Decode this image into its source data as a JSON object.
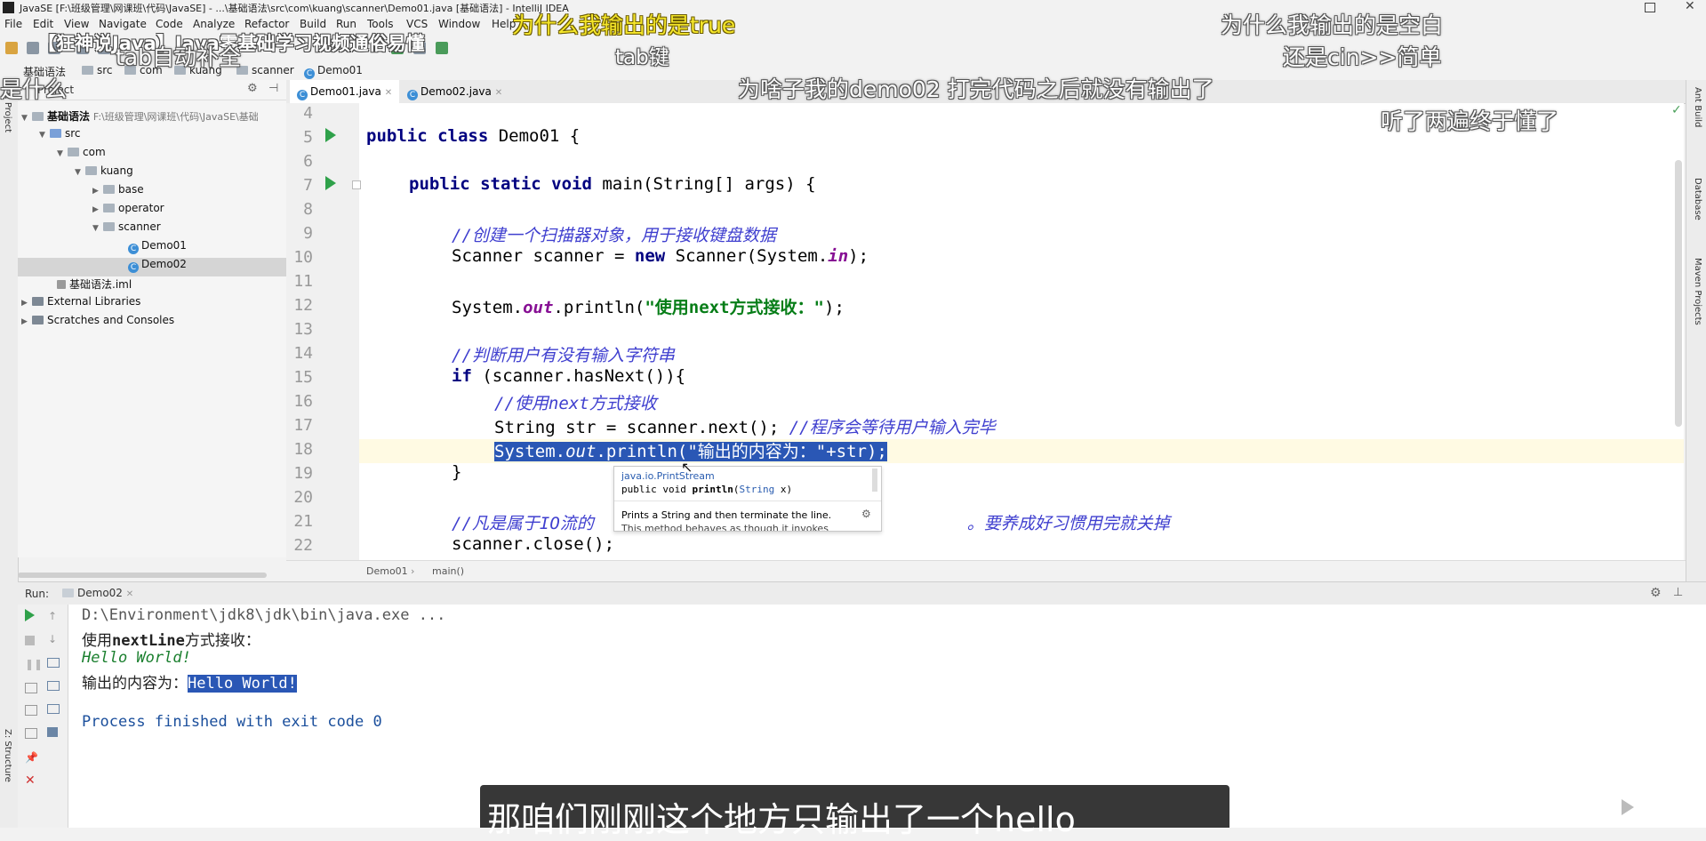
{
  "window": {
    "title": "JavaSE [F:\\班级管理\\网课班\\代码\\JavaSE] - ...\\基础语法\\src\\com\\kuang\\scanner\\Demo01.java [基础语法] - IntelliJ IDEA"
  },
  "overlay_title": "【狂神说Java】Java零基础学习视频通俗易懂",
  "menu": [
    "File",
    "Edit",
    "View",
    "Navigate",
    "Code",
    "Analyze",
    "Refactor",
    "Build",
    "Run",
    "Tools",
    "VCS",
    "Window",
    "Help"
  ],
  "breadcrumb": [
    "基础语法",
    "src",
    "com",
    "kuang",
    "scanner",
    "Demo01"
  ],
  "project": {
    "header": "Project",
    "root_name": "基础语法",
    "root_path": "F:\\班级管理\\网课班\\代码\\JavaSE\\基础",
    "items": [
      "src",
      "com",
      "kuang",
      "base",
      "operator",
      "scanner",
      "Demo01",
      "Demo02",
      "基础语法.iml",
      "External Libraries",
      "Scratches and Consoles"
    ]
  },
  "editor_tabs": [
    "Demo01.java",
    "Demo02.java"
  ],
  "code": {
    "line_numbers": [
      "4",
      "5",
      "6",
      "7",
      "8",
      "9",
      "10",
      "11",
      "12",
      "13",
      "14",
      "15",
      "16",
      "17",
      "18",
      "19",
      "20",
      "21",
      "22"
    ],
    "l5_kw": "public class",
    "l5_rest": " Demo01 {",
    "l7_kw": "public static void",
    "l7_rest": " main(String[] args) {",
    "l9": "//创建一个扫描器对象，用于接收键盘数据",
    "l10_a": "Scanner scanner = ",
    "l10_kw": "new",
    "l10_b": " Scanner(System.",
    "l10_fld": "in",
    "l10_c": ");",
    "l12_a": "System.",
    "l12_fld": "out",
    "l12_b": ".println(",
    "l12_str": "\"使用next方式接收：\"",
    "l12_c": ");",
    "l14": "//判断用户有没有输入字符串",
    "l15_kw": "if",
    "l15_rest": " (scanner.hasNext()){",
    "l16": "//使用next方式接收",
    "l17_a": "String str = scanner.next(); ",
    "l17_cm": "//程序会等待用户输入完毕",
    "l18_a": "System.",
    "l18_fld": "out",
    "l18_b": ".println(\"输出的内容为：\"+str);",
    "l19": "}",
    "l21_a": "//凡是属于IO流的",
    "l21_b": "。要养成好习惯用完就关掉",
    "l22": "scanner.close();"
  },
  "doc_popup": {
    "pkg": "java.io.PrintStream",
    "sig_a": "public void ",
    "sig_b": "println",
    "sig_c": "(",
    "sig_type": "String",
    "sig_d": " x)",
    "desc": "Prints a String and then terminate the line.",
    "desc2": "This method behaves as though it invokes"
  },
  "editor_breadcrumb": [
    "Demo01",
    "main()"
  ],
  "run": {
    "label": "Run:",
    "tab": "Demo02",
    "lines": {
      "cmd": "D:\\Environment\\jdk8\\jdk\\bin\\java.exe ...",
      "l2_a": "使用",
      "l2_b": "nextLine",
      "l2_c": "方式接收：",
      "l3": "Hello World!",
      "l4_a": "输出的内容为：",
      "l4_b": "Hello World!",
      "l6": "Process finished with exit code 0"
    }
  },
  "right_tools": [
    "Ant Build",
    "Database",
    "Maven Projects"
  ],
  "left_tools": [
    "1: Project",
    "Z: Structure"
  ],
  "danmaku": [
    "为什么我输出的是true",
    "tab键",
    "为什么我输出的是空白",
    "还是cin>>简单",
    "为啥子我的demo02 打完代码之后就没有输出了",
    "听了两遍终于懂了",
    "tab自动补全",
    "是什么"
  ],
  "subtitle": "那咱们刚刚这个地方只输出了一个hello",
  "colors": {
    "selection": "#2a57b5",
    "keyword": "#000080",
    "comment": "#3f3fcf",
    "string": "#067d17",
    "run_green": "#2fa14a"
  }
}
